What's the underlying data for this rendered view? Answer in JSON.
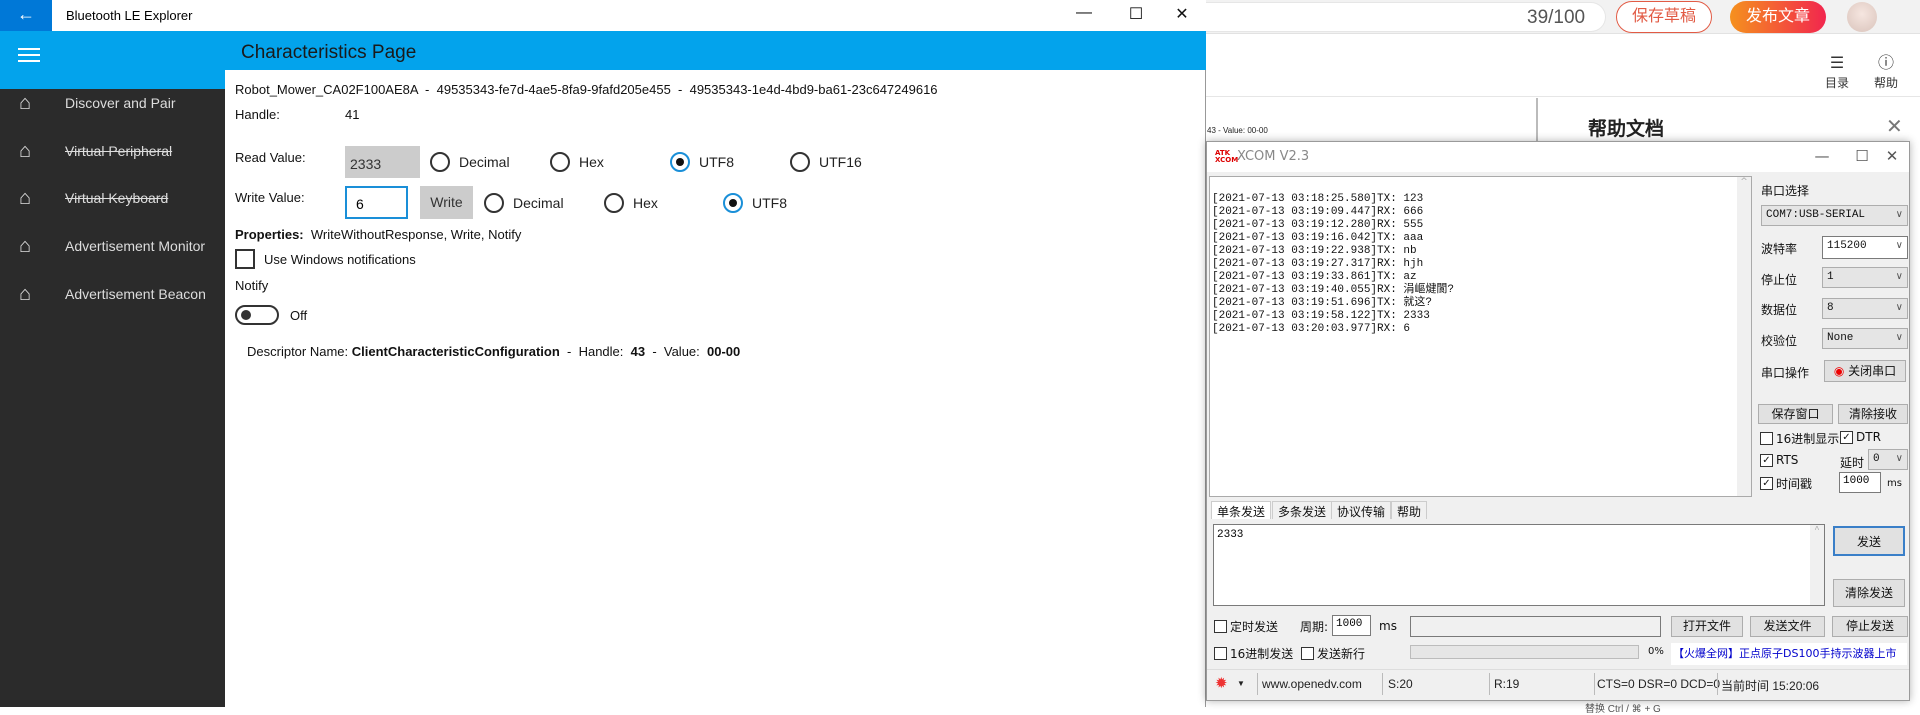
{
  "browser": {
    "counter": "39/100",
    "save_draft": "保存草稿",
    "publish": "发布文章",
    "toc_label": "目录",
    "help_label": "帮助",
    "editor_snippet": "43 - Value: 00-00",
    "help_panel_title": "帮助文档",
    "below_snippet": "替换            Ctrl / ⌘ + G"
  },
  "bt": {
    "app_title": "Bluetooth LE Explorer",
    "page_title": "Characteristics Page",
    "nav": [
      {
        "label": "Discover and Pair",
        "disabled": false
      },
      {
        "label": "Virtual Peripheral",
        "disabled": true
      },
      {
        "label": "Virtual Keyboard",
        "disabled": true
      },
      {
        "label": "Advertisement Monitor",
        "disabled": false
      },
      {
        "label": "Advertisement Beacon",
        "disabled": false
      }
    ],
    "path": "Robot_Mower_CA02F100AE8A  -  49535343-fe7d-4ae5-8fa9-9fafd205e455  -  49535343-1e4d-4bd9-ba61-23c647249616",
    "handle_label": "Handle:",
    "handle_value": "41",
    "read_label": "Read Value:",
    "read_value": "2333",
    "read_formats": [
      "Decimal",
      "Hex",
      "UTF8",
      "UTF16"
    ],
    "read_selected": "UTF8",
    "write_label": "Write Value:",
    "write_value": "6",
    "write_button": "Write",
    "write_formats": [
      "Decimal",
      "Hex",
      "UTF8"
    ],
    "write_selected": "UTF8",
    "properties_label": "Properties:",
    "properties_value": "WriteWithoutResponse, Write, Notify",
    "use_notifications_label": "Use Windows notifications",
    "use_notifications_checked": false,
    "notify_label": "Notify",
    "notify_state": "Off",
    "descriptor": {
      "name_label": "Descriptor Name:",
      "name": "ClientCharacteristicConfiguration",
      "handle_label": "Handle:",
      "handle": "43",
      "value_label": "Value:",
      "value": "00-00"
    },
    "accent": "#03a3ec"
  },
  "xcom": {
    "title": "XCOM V2.3",
    "log": [
      "[2021-07-13 03:18:25.580]TX: 123",
      "[2021-07-13 03:19:09.447]RX: 666",
      "[2021-07-13 03:19:12.280]RX: 555",
      "[2021-07-13 03:19:16.042]TX: aaa",
      "[2021-07-13 03:19:22.938]TX: nb",
      "[2021-07-13 03:19:27.317]RX: hjh",
      "[2021-07-13 03:19:33.861]TX: az",
      "[2021-07-13 03:19:40.055]RX: 涓嶇煡閬?",
      "[2021-07-13 03:19:51.696]TX: 就这?",
      "[2021-07-13 03:19:58.122]TX: 2333",
      "[2021-07-13 03:20:03.977]RX: 6"
    ],
    "port_select_label": "串口选择",
    "port": "COM7:USB-SERIAL",
    "baud_label": "波特率",
    "baud": "115200",
    "stop_label": "停止位",
    "stop": "1",
    "data_label": "数据位",
    "data_bits": "8",
    "parity_label": "校验位",
    "parity": "None",
    "port_op_label": "串口操作",
    "close_port": "关闭串口",
    "save_window": "保存窗口",
    "clear_receive": "清除接收",
    "hex_display": "16进制显示",
    "dtr": "DTR",
    "rts": "RTS",
    "delay_label": "延时",
    "delay": "0",
    "timestamp": "时间戳",
    "timestamp_ms": "1000",
    "ms": "ms",
    "tabs": [
      "单条发送",
      "多条发送",
      "协议传输",
      "帮助"
    ],
    "send_text": "2333",
    "send": "发送",
    "clear_send": "清除发送",
    "timed_send": "定时发送",
    "period_label": "周期:",
    "period": "1000",
    "period_unit": "ms",
    "open_file": "打开文件",
    "send_file": "发送文件",
    "stop_send": "停止发送",
    "hex_send": "16进制发送",
    "send_newline": "发送新行",
    "progress": "0%",
    "ad": "【火爆全网】正点原子DS100手持示波器上市",
    "status": {
      "site": "www.openedv.com",
      "sent": "S:20",
      "received": "R:19",
      "lines": "CTS=0 DSR=0 DCD=0",
      "time": "当前时间 15:20:06"
    }
  }
}
